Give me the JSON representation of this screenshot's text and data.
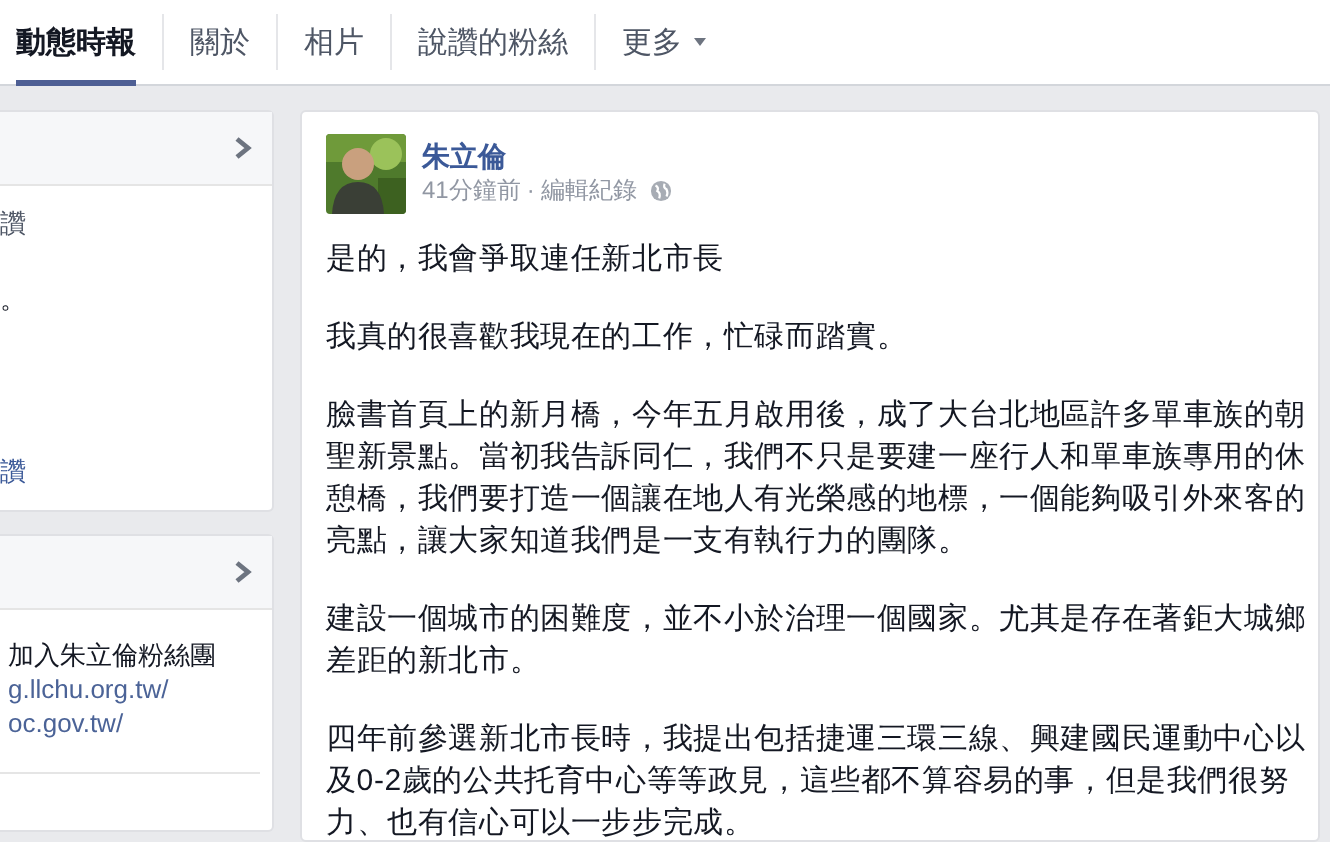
{
  "tabs": [
    {
      "label": "動態時報",
      "selected": true,
      "kind": "tab"
    },
    {
      "label": "關於",
      "selected": false,
      "kind": "tab"
    },
    {
      "label": "相片",
      "selected": false,
      "kind": "tab"
    },
    {
      "label": "說讚的粉絲",
      "selected": false,
      "kind": "tab"
    },
    {
      "label": "更多",
      "selected": false,
      "kind": "menu"
    }
  ],
  "sidebar": {
    "cards": [
      {
        "sections": [
          [
            {
              "text": "讚",
              "kind": "muted"
            }
          ],
          [
            {
              "text": "。",
              "kind": "plain"
            },
            {
              "text": "讚",
              "kind": "link"
            }
          ]
        ]
      },
      {
        "sections": [
          [
            {
              "text": "加入朱立倫粉絲團",
              "kind": "plain"
            },
            {
              "text": "g.llchu.org.tw/",
              "kind": "link"
            },
            {
              "text": "oc.gov.tw/",
              "kind": "link"
            }
          ]
        ]
      }
    ]
  },
  "post": {
    "author": "朱立倫",
    "time": "41分鐘前",
    "separator": "·",
    "edit_history": "編輯紀錄",
    "paragraphs": [
      "是的，我會爭取連任新北市長",
      "我真的很喜歡我現在的工作，忙碌而踏實。",
      "臉書首頁上的新月橋，今年五月啟用後，成了大台北地區許多單車族的朝聖新景點。當初我告訴同仁，我們不只是要建一座行人和單車族專用的休憩橋，我們要打造一個讓在地人有光榮感的地標，一個能夠吸引外來客的亮點，讓大家知道我們是一支有執行力的團隊。",
      "建設一個城市的困難度，並不小於治理一個國家。尤其是存在著鉅大城鄉差距的新北市。",
      "四年前參選新北市長時，我提出包括捷運三環三線、興建國民運動中心以及0-2歲的公共托育中心等等政見，這些都不算容易的事，但是我們很努力、也有信心可以一步步完成。"
    ]
  }
}
